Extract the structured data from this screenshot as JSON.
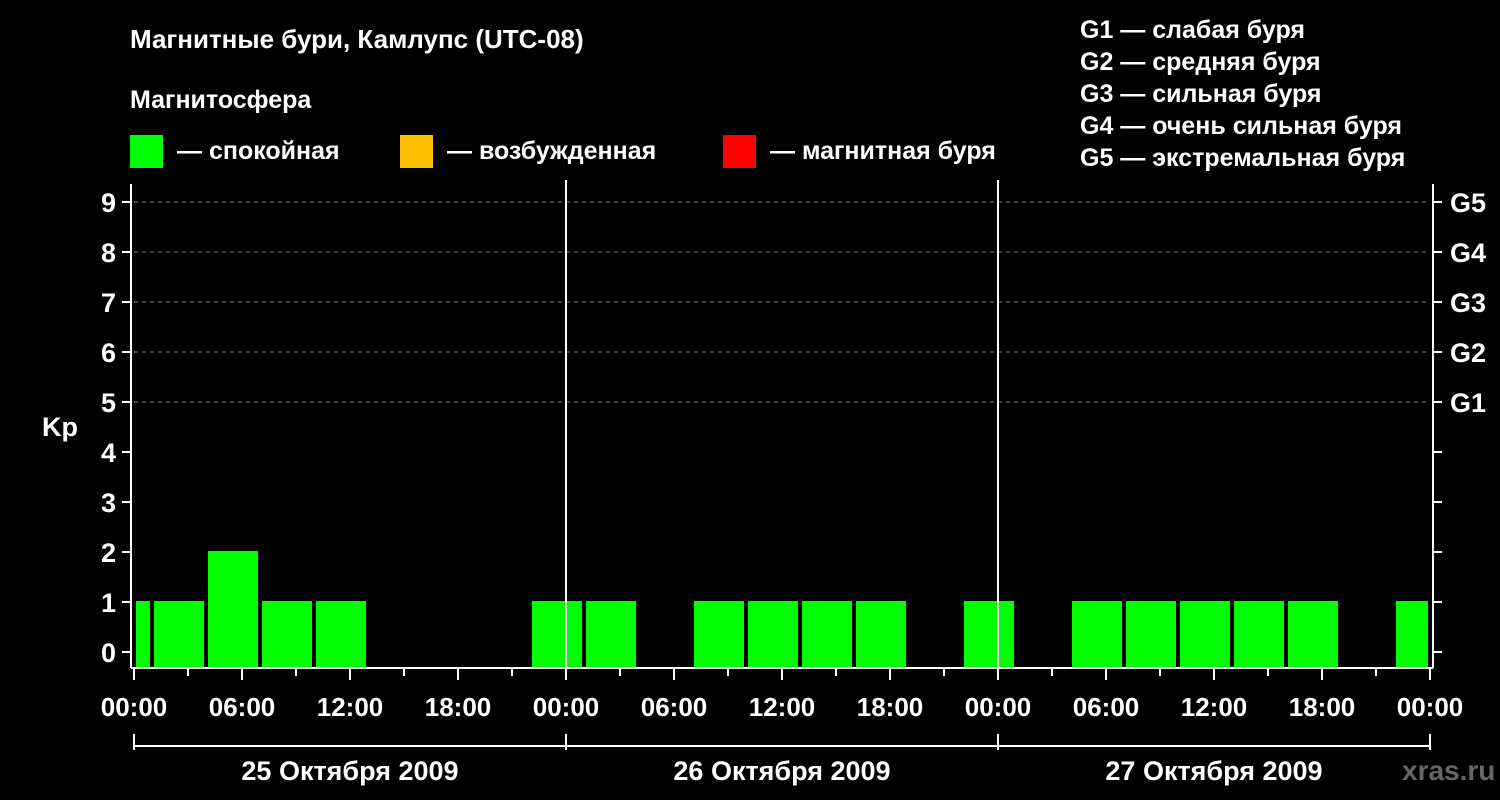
{
  "title": "Магнитные бури, Камлупс (UTC-08)",
  "subtitle": "Магнитосфера",
  "legend": [
    {
      "color": "#00ff00",
      "label": "— спокойная"
    },
    {
      "color": "#ffbf00",
      "label": "— возбужденная"
    },
    {
      "color": "#ff0000",
      "label": "— магнитная буря"
    }
  ],
  "g_levels": [
    "G1 — слабая буря",
    "G2 — средняя буря",
    "G3 — сильная буря",
    "G4 — очень сильная буря",
    "G5 — экстремальная буря"
  ],
  "watermark": "xras.ru",
  "chart_data": {
    "type": "bar",
    "ylabel": "Kp",
    "ylim": [
      0,
      9
    ],
    "y_ticks": [
      "0",
      "1",
      "2",
      "3",
      "4",
      "5",
      "6",
      "7",
      "8",
      "9"
    ],
    "y2_ticks": [
      {
        "value": 5,
        "label": "G1"
      },
      {
        "value": 6,
        "label": "G2"
      },
      {
        "value": 7,
        "label": "G3"
      },
      {
        "value": 8,
        "label": "G4"
      },
      {
        "value": 9,
        "label": "G5"
      }
    ],
    "grid": "dashed horizontal at Kp 5–9",
    "xlim_hours": [
      0,
      72
    ],
    "x_tick_labels": [
      {
        "hour": 0,
        "label": "00:00"
      },
      {
        "hour": 6,
        "label": "06:00"
      },
      {
        "hour": 12,
        "label": "12:00"
      },
      {
        "hour": 18,
        "label": "18:00"
      },
      {
        "hour": 24,
        "label": "00:00"
      },
      {
        "hour": 30,
        "label": "06:00"
      },
      {
        "hour": 36,
        "label": "12:00"
      },
      {
        "hour": 42,
        "label": "18:00"
      },
      {
        "hour": 48,
        "label": "00:00"
      },
      {
        "hour": 54,
        "label": "06:00"
      },
      {
        "hour": 60,
        "label": "12:00"
      },
      {
        "hour": 66,
        "label": "18:00"
      },
      {
        "hour": 72,
        "label": "00:00"
      }
    ],
    "days": [
      "25 Октября 2009",
      "26 Октября 2009",
      "27 Октября 2009"
    ],
    "bars": [
      {
        "start": 0,
        "end": 1,
        "kp": 1
      },
      {
        "start": 1,
        "end": 4,
        "kp": 1
      },
      {
        "start": 4,
        "end": 7,
        "kp": 2
      },
      {
        "start": 7,
        "end": 10,
        "kp": 1
      },
      {
        "start": 10,
        "end": 13,
        "kp": 1
      },
      {
        "start": 22,
        "end": 25,
        "kp": 1
      },
      {
        "start": 25,
        "end": 28,
        "kp": 1
      },
      {
        "start": 31,
        "end": 34,
        "kp": 1
      },
      {
        "start": 34,
        "end": 37,
        "kp": 1
      },
      {
        "start": 37,
        "end": 40,
        "kp": 1
      },
      {
        "start": 40,
        "end": 43,
        "kp": 1
      },
      {
        "start": 46,
        "end": 49,
        "kp": 1
      },
      {
        "start": 52,
        "end": 55,
        "kp": 1
      },
      {
        "start": 55,
        "end": 58,
        "kp": 1
      },
      {
        "start": 58,
        "end": 61,
        "kp": 1
      },
      {
        "start": 61,
        "end": 64,
        "kp": 1
      },
      {
        "start": 64,
        "end": 67,
        "kp": 1
      },
      {
        "start": 70,
        "end": 72,
        "kp": 1
      }
    ],
    "bar_color": "#00ff00"
  }
}
